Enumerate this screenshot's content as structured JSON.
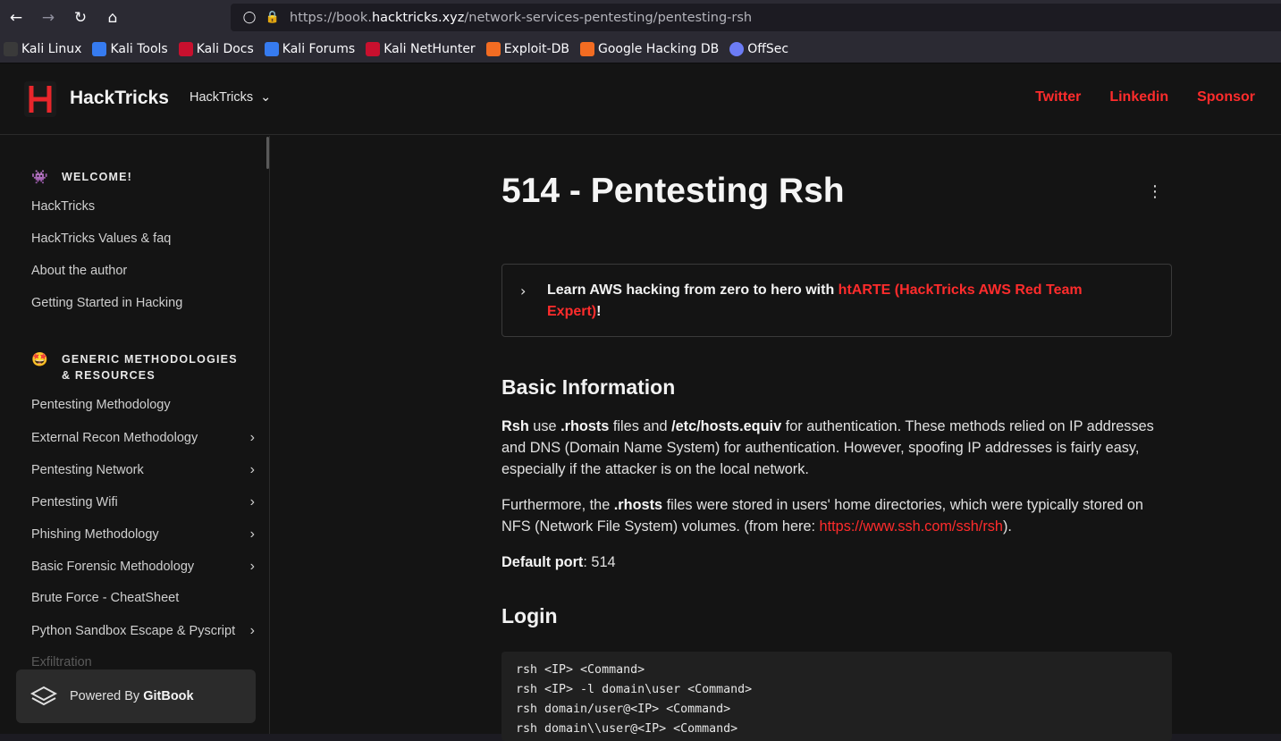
{
  "browser": {
    "url_prefix": "https://book.",
    "url_host": "hacktricks.xyz",
    "url_path": "/network-services-pentesting/pentesting-rsh",
    "bookmarks": [
      {
        "label": "Kali Linux",
        "color": "#d0d0d0"
      },
      {
        "label": "Kali Tools",
        "color": "#367bf0"
      },
      {
        "label": "Kali Docs",
        "color": "#c8102e"
      },
      {
        "label": "Kali Forums",
        "color": "#367bf0"
      },
      {
        "label": "Kali NetHunter",
        "color": "#c8102e"
      },
      {
        "label": "Exploit-DB",
        "color": "#f26c22"
      },
      {
        "label": "Google Hacking DB",
        "color": "#f26c22"
      },
      {
        "label": "OffSec",
        "color": "#6c7cf5"
      }
    ]
  },
  "header": {
    "site_title": "HackTricks",
    "space_label": "HackTricks",
    "links": [
      "Twitter",
      "Linkedin",
      "Sponsor"
    ],
    "accent": "#ff2c2c"
  },
  "sidebar": {
    "welcome_section": "WELCOME!",
    "welcome_items": [
      "HackTricks",
      "HackTricks Values & faq",
      "About the author",
      "Getting Started in Hacking"
    ],
    "generic_section": "GENERIC METHODOLOGIES & RESOURCES",
    "generic_items": [
      {
        "label": "Pentesting Methodology",
        "expandable": false
      },
      {
        "label": "External Recon Methodology",
        "expandable": true
      },
      {
        "label": "Pentesting Network",
        "expandable": true
      },
      {
        "label": "Pentesting Wifi",
        "expandable": true
      },
      {
        "label": "Phishing Methodology",
        "expandable": true
      },
      {
        "label": "Basic Forensic Methodology",
        "expandable": true
      },
      {
        "label": "Brute Force - CheatSheet",
        "expandable": false
      },
      {
        "label": "Python Sandbox Escape & Pyscript",
        "expandable": true
      },
      {
        "label": "Exfiltration",
        "expandable": false
      }
    ],
    "gitbook_prefix": "Powered By ",
    "gitbook_brand": "GitBook"
  },
  "content": {
    "title": "514 - Pentesting Rsh",
    "callout_text": "Learn AWS hacking from zero to hero with ",
    "callout_link": "htARTE (HackTricks AWS Red Team Expert)",
    "callout_suffix": "!",
    "h_basic": "Basic Information",
    "p1_parts": [
      "Rsh",
      " use ",
      ".rhosts",
      " files and ",
      "/etc/hosts.equiv",
      " for authentication. These methods relied on IP addresses and DNS (Domain Name System) for authentication. However, spoofing IP addresses is fairly easy, especially if the attacker is on the local network."
    ],
    "p2_parts": [
      "Furthermore, the ",
      ".rhosts",
      " files were stored in users' home directories, which were typically stored on NFS (Network File System) volumes. (from here: ",
      "https://www.ssh.com/ssh/rsh",
      ")."
    ],
    "p3_label": "Default port",
    "p3_value": ": 514",
    "h_login": "Login",
    "code_lines": [
      "rsh <IP> <Command>",
      "rsh <IP> -l domain\\user <Command>",
      "rsh domain/user@<IP> <Command>",
      "rsh domain\\\\user@<IP> <Command>"
    ]
  }
}
